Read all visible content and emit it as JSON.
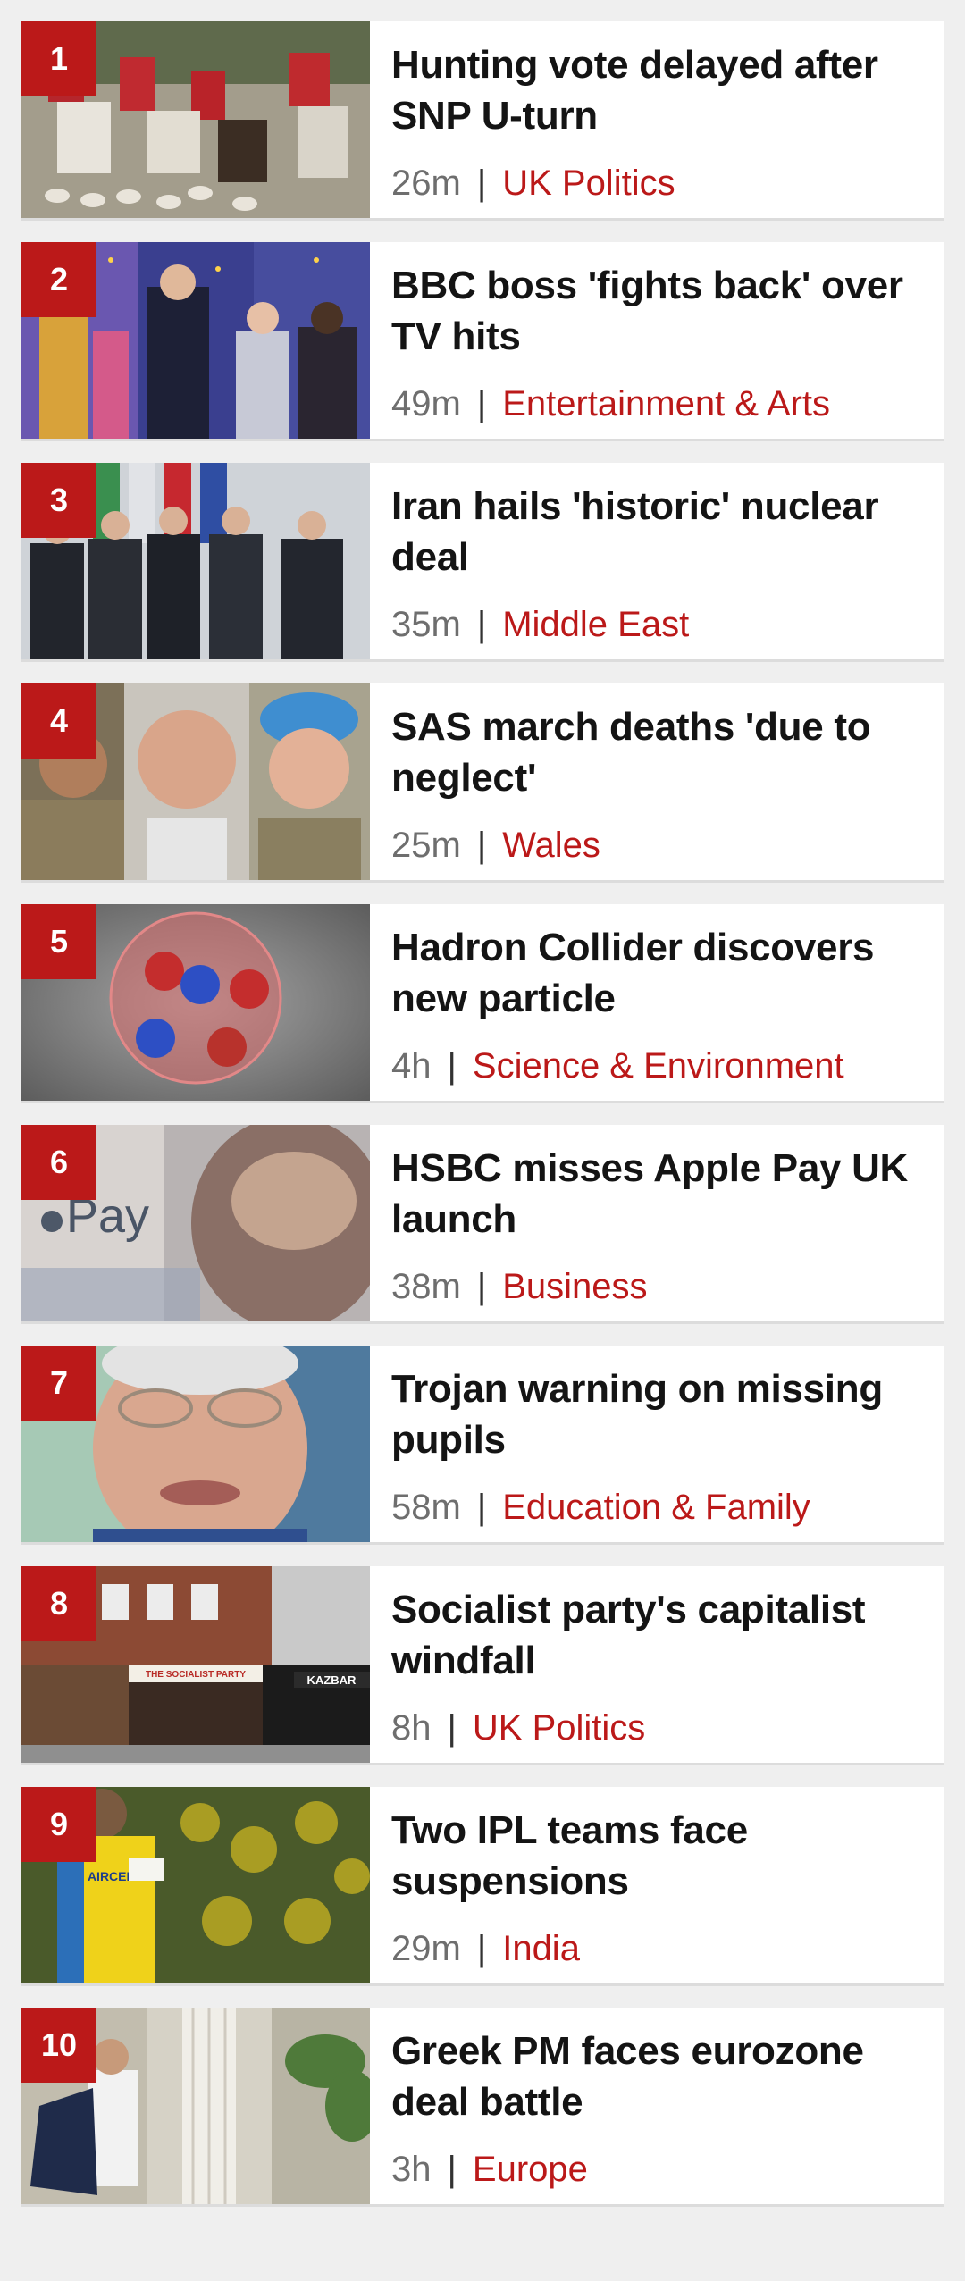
{
  "stories": [
    {
      "rank": "1",
      "headline": "Hunting vote delayed after SNP U-turn",
      "age": "26m",
      "separator": "|",
      "section": "UK Politics",
      "image": "fox-hunt-riders-photo"
    },
    {
      "rank": "2",
      "headline": "BBC boss 'fights back' over TV hits",
      "age": "49m",
      "separator": "|",
      "section": "Entertainment & Arts",
      "image": "tv-show-stage-photo"
    },
    {
      "rank": "3",
      "headline": "Iran hails 'historic' nuclear deal",
      "age": "35m",
      "separator": "|",
      "section": "Middle East",
      "image": "diplomats-group-photo"
    },
    {
      "rank": "4",
      "headline": "SAS march deaths 'due to neglect'",
      "age": "25m",
      "separator": "|",
      "section": "Wales",
      "image": "soldiers-portraits-photo"
    },
    {
      "rank": "5",
      "headline": "Hadron Collider discovers new particle",
      "age": "4h",
      "separator": "|",
      "section": "Science & Environment",
      "image": "particle-illustration"
    },
    {
      "rank": "6",
      "headline": "HSBC misses Apple Pay UK launch",
      "age": "38m",
      "separator": "|",
      "section": "Business",
      "image": "apple-pay-photo"
    },
    {
      "rank": "7",
      "headline": "Trojan warning on missing pupils",
      "age": "58m",
      "separator": "|",
      "section": "Education & Family",
      "image": "man-portrait-photo"
    },
    {
      "rank": "8",
      "headline": "Socialist party's capitalist windfall",
      "age": "8h",
      "separator": "|",
      "section": "UK Politics",
      "image": "street-shopfront-photo"
    },
    {
      "rank": "9",
      "headline": "Two IPL teams face suspensions",
      "age": "29m",
      "separator": "|",
      "section": "India",
      "image": "cricketer-photo"
    },
    {
      "rank": "10",
      "headline": "Greek PM faces eurozone deal battle",
      "age": "3h",
      "separator": "|",
      "section": "Europe",
      "image": "pm-columns-photo"
    }
  ],
  "image_text": {
    "pay_label": "Pay",
    "shop_sign": "THE SOCIALIST PARTY",
    "shop_sign_2": "KAZBAR",
    "jersey_text": "AIRCEL"
  },
  "colors": {
    "accent": "#bb1919",
    "headline": "#141414",
    "meta": "#6e6e6e",
    "background": "#efefef"
  }
}
